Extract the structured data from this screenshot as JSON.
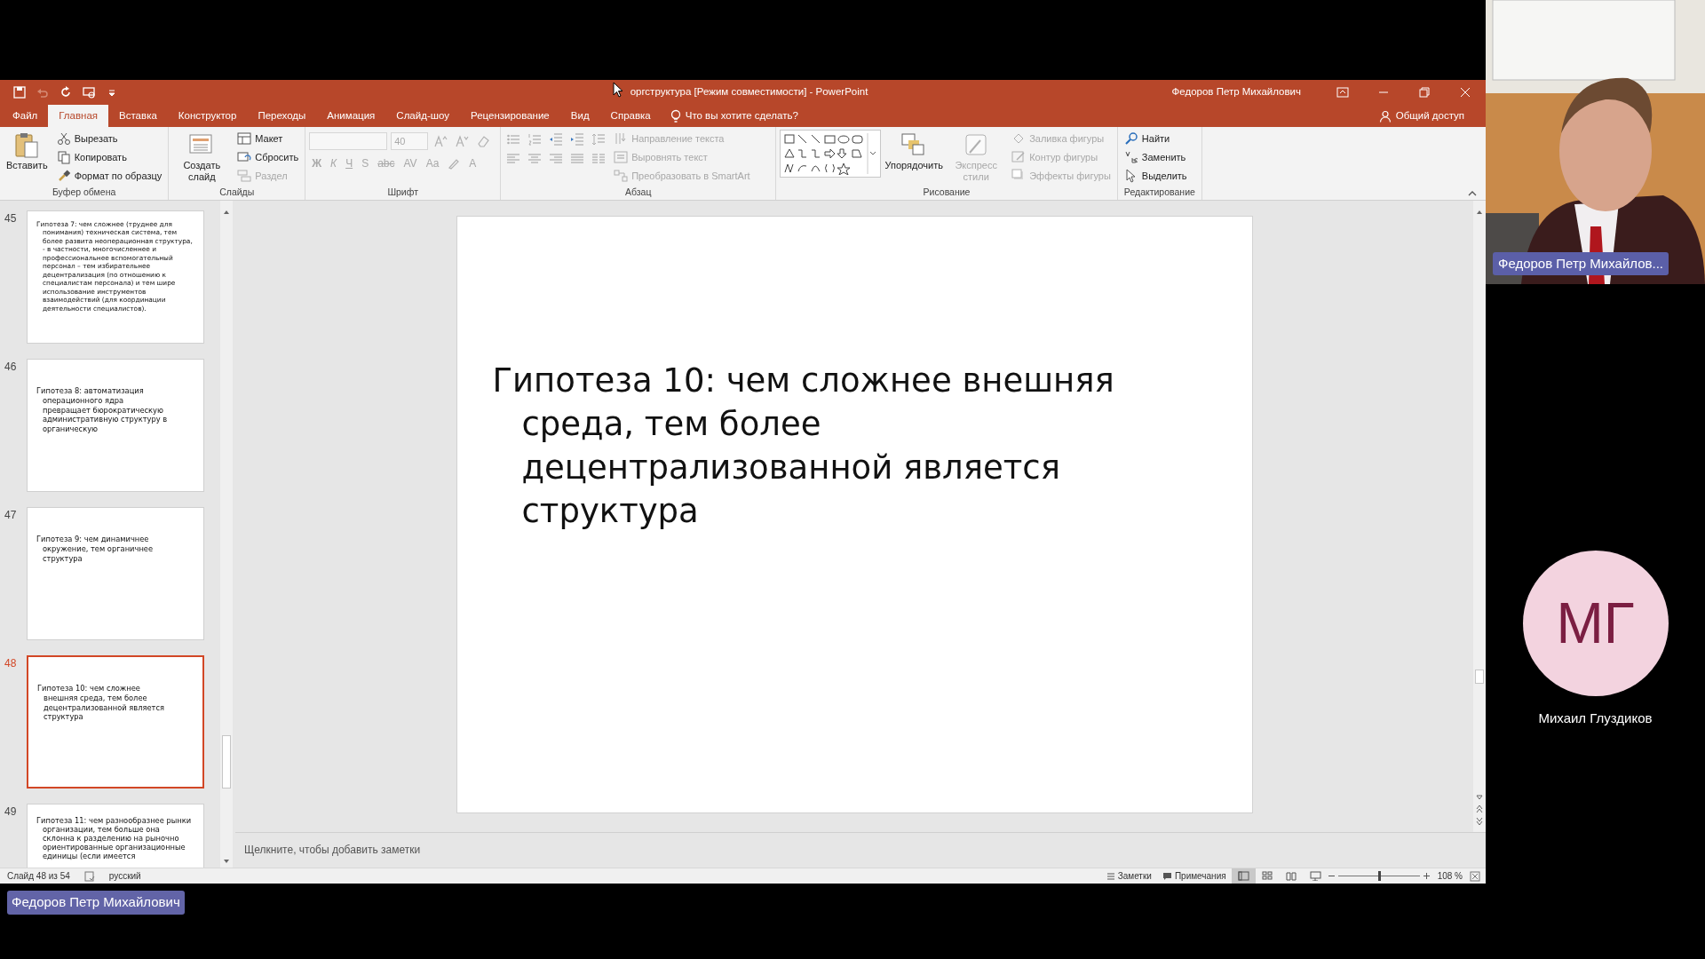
{
  "title_bar": {
    "quick_access": [
      {
        "disabled": false
      },
      {
        "disabled": true
      },
      {
        "disabled": false
      },
      {
        "disabled": false
      },
      {
        "disabled": false
      }
    ],
    "title": "оргструктура [Режим совместимости]  -  PowerPoint",
    "user": "Федоров Петр Михайлович"
  },
  "tabs": [
    {
      "label": "Файл",
      "selected": false
    },
    {
      "label": "Главная",
      "selected": true
    },
    {
      "label": "Вставка",
      "selected": false
    },
    {
      "label": "Конструктор",
      "selected": false
    },
    {
      "label": "Переходы",
      "selected": false
    },
    {
      "label": "Анимация",
      "selected": false
    },
    {
      "label": "Слайд-шоу",
      "selected": false
    },
    {
      "label": "Рецензирование",
      "selected": false
    },
    {
      "label": "Вид",
      "selected": false
    },
    {
      "label": "Справка",
      "selected": false
    }
  ],
  "tell_me": "Что вы хотите сделать?",
  "share": "Общий доступ",
  "ribbon": [
    {
      "label": "Буфер обмена",
      "items": [
        {
          "kind": "large",
          "label": "Вставить",
          "disabled": false
        },
        {
          "kind": "stack",
          "items": [
            {
              "label": "Вырезать",
              "disabled": false
            },
            {
              "label": "Копировать",
              "disabled": false
            },
            {
              "label": "Формат по образцу",
              "disabled": false
            }
          ]
        }
      ]
    },
    {
      "label": "Слайды",
      "items": [
        {
          "kind": "large",
          "label": "Создать слайд",
          "disabled": false
        },
        {
          "kind": "stack",
          "items": [
            {
              "label": "Макет",
              "disabled": false
            },
            {
              "label": "Сбросить",
              "disabled": false
            },
            {
              "label": "Раздел",
              "disabled": true
            }
          ]
        }
      ]
    },
    {
      "label": "Шрифт",
      "items": [
        {
          "kind": "rows",
          "rows": [
            [
              {
                "kind": "field",
                "disabled": true
              },
              {
                "kind": "field",
                "value": "40",
                "disabled": true
              },
              {
                "kind": "icon",
                "disabled": true
              },
              {
                "kind": "icon",
                "disabled": true
              },
              {
                "kind": "icon",
                "disabled": true
              }
            ],
            [
              {
                "kind": "glyph",
                "label": "Ж",
                "disabled": true
              },
              {
                "kind": "glyph",
                "label": "К",
                "disabled": true
              },
              {
                "kind": "glyph",
                "label": "Ч",
                "disabled": true
              },
              {
                "kind": "glyph",
                "label": "S",
                "disabled": true
              },
              {
                "kind": "glyph",
                "label": "abc",
                "disabled": true
              },
              {
                "kind": "glyph",
                "label": "AV",
                "disabled": true
              },
              {
                "kind": "glyph",
                "label": "Aa",
                "disabled": true
              },
              {
                "kind": "icon",
                "disabled": true
              },
              {
                "kind": "glyph",
                "label": "A",
                "disabled": true
              }
            ]
          ]
        }
      ]
    },
    {
      "label": "Абзац",
      "items": [
        {
          "kind": "rows",
          "rows": [
            [
              {
                "kind": "icon",
                "disabled": true
              },
              {
                "kind": "icon",
                "disabled": true
              },
              {
                "kind": "icon",
                "disabled": true
              },
              {
                "kind": "icon",
                "disabled": true
              },
              {
                "kind": "icon",
                "disabled": true
              }
            ],
            [
              {
                "kind": "icon",
                "disabled": true
              },
              {
                "kind": "icon",
                "disabled": true
              },
              {
                "kind": "icon",
                "disabled": true
              },
              {
                "kind": "icon",
                "disabled": true
              },
              {
                "kind": "icon",
                "disabled": true
              }
            ]
          ]
        },
        {
          "kind": "stack",
          "items": [
            {
              "label": "Направление текста",
              "disabled": true
            },
            {
              "label": "Выровнять текст",
              "disabled": true
            },
            {
              "label": "Преобразовать в SmartArt",
              "disabled": true
            }
          ]
        }
      ]
    },
    {
      "label": "Рисование",
      "items": [
        {
          "kind": "gallery",
          "disabled": false
        },
        {
          "kind": "large",
          "label": "Упорядочить",
          "disabled": false
        },
        {
          "kind": "large",
          "label": "Экспресс стили",
          "disabled": true
        },
        {
          "kind": "stack",
          "items": [
            {
              "label": "Заливка фигуры",
              "disabled": true
            },
            {
              "label": "Контур фигуры",
              "disabled": true
            },
            {
              "label": "Эффекты фигуры",
              "disabled": true
            }
          ]
        }
      ]
    },
    {
      "label": "Редактирование",
      "items": [
        {
          "kind": "stack",
          "items": [
            {
              "label": "Найти",
              "disabled": false
            },
            {
              "label": "Заменить",
              "disabled": false
            },
            {
              "label": "Выделить",
              "disabled": false
            }
          ]
        }
      ]
    }
  ],
  "slides": [
    {
      "number": "45",
      "text": "Гипотеза 7: чем сложнее (труднее для понимания) техническая система, тем более развита неоперационная структура, - в частности, многочисленнее и профессиональнее вспомогательный персонал – тем избирательнее децентрализация (по отношению к специалистам персонала) и тем шире использование инструментов взаимодействий (для координации деятельности специалистов).",
      "selected": false
    },
    {
      "number": "46",
      "text": "Гипотеза 8: автоматизация операционного ядра превращает бюрократическую административную структуру в органическую",
      "selected": false
    },
    {
      "number": "47",
      "text": "Гипотеза 9: чем динамичнее окружение, тем органичнее структура",
      "selected": false
    },
    {
      "number": "48",
      "text": "Гипотеза 10: чем сложнее внешняя среда, тем более децентрализованной является структура",
      "selected": true
    },
    {
      "number": "49",
      "text": "Гипотеза 11: чем разнообразнее рынки организации, тем больше она склонна к разделению на рыночно ориентированные организационные единицы (если имеется",
      "selected": false
    }
  ],
  "slide_text": "Гипотеза 10: чем сложнее внешняя среда, тем более децентрализованной является структура",
  "notes_placeholder": "Щелкните, чтобы добавить заметки",
  "status_bar": {
    "slide_counter": "Слайд 48 из 54",
    "language": "русский",
    "notes": "Заметки",
    "comments": "Примечания",
    "views": [
      {
        "selected": true
      },
      {
        "selected": false
      },
      {
        "selected": false
      },
      {
        "selected": false
      }
    ],
    "zoom_slider": {
      "level": 0.5
    },
    "zoom": "108 %"
  },
  "participants": [
    {
      "kind": "video",
      "name": "Федоров Петр Михайлов..."
    },
    {
      "kind": "avatar",
      "initials": "МГ",
      "name": "Михаил Глуздиков"
    }
  ],
  "presenter_label": "Федоров Петр Михайлович"
}
